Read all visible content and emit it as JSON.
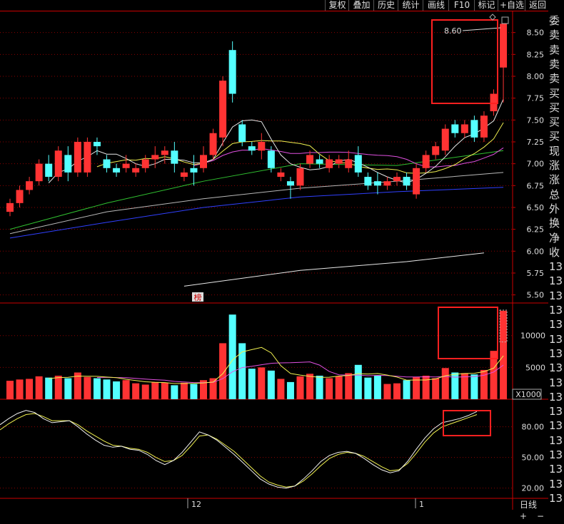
{
  "toolbar": {
    "buttons": [
      "复权",
      "叠加",
      "历史",
      "统计",
      "画线",
      "F10",
      "标记",
      "+自选",
      "返回"
    ]
  },
  "main_chart": {
    "price_ticks": [
      "8.50",
      "8.25",
      "8.00",
      "7.75",
      "7.50",
      "7.25",
      "7.00",
      "6.75",
      "6.50",
      "6.25",
      "6.00",
      "5.75",
      "5.50"
    ],
    "callout_value": "8.60",
    "marker": "榜"
  },
  "volume_chart": {
    "ticks": [
      "10000",
      "5000"
    ],
    "unit": "X1000"
  },
  "kdj_chart": {
    "ticks": [
      "80.00",
      "50.00",
      "20.00"
    ]
  },
  "date_axis": {
    "labels": [
      "12",
      "1"
    ]
  },
  "right_panel": {
    "labels": [
      "委",
      "卖",
      "卖",
      "卖",
      "卖",
      "买",
      "买",
      "买",
      "买",
      "现",
      "涨",
      "涨",
      "总",
      "外",
      "换",
      "净",
      "收",
      "13",
      "13",
      "13",
      "13",
      "13",
      "13",
      "13",
      "13",
      "13",
      "13",
      "13",
      "13",
      "13",
      "13",
      "13",
      "13",
      "13"
    ]
  },
  "bottom_tabs": {
    "period": "日线",
    "plus": "+",
    "minus": "−"
  },
  "colors": {
    "up": "#ff3333",
    "down": "#54ffff",
    "grid": "#8b0000",
    "axis": "#cc0000",
    "highlight": "#ff2020",
    "ma_white": "#e8e8e8",
    "ma_yellow": "#f0f050",
    "ma_magenta": "#e050e0",
    "ma_green": "#30c030",
    "ma_blue": "#3040ff",
    "ma_gray": "#b8b8b8"
  },
  "chart_data": {
    "type": "candlestick",
    "ylim": [
      5.5,
      8.6
    ],
    "candles": [
      [
        6.45,
        6.6,
        6.4,
        6.55
      ],
      [
        6.55,
        6.75,
        6.5,
        6.7
      ],
      [
        6.7,
        6.85,
        6.65,
        6.8
      ],
      [
        6.8,
        7.05,
        6.75,
        7.0
      ],
      [
        7.0,
        7.1,
        6.8,
        6.85
      ],
      [
        6.85,
        7.2,
        6.8,
        7.15
      ],
      [
        7.1,
        7.2,
        6.8,
        6.9
      ],
      [
        6.9,
        7.3,
        6.85,
        7.25
      ],
      [
        6.9,
        7.3,
        6.85,
        7.25
      ],
      [
        7.25,
        7.3,
        7.1,
        7.2
      ],
      [
        7.05,
        7.1,
        6.9,
        6.95
      ],
      [
        6.95,
        7.0,
        6.85,
        6.9
      ],
      [
        6.95,
        7.1,
        6.9,
        7.0
      ],
      [
        6.9,
        7.0,
        6.85,
        6.95
      ],
      [
        6.95,
        7.1,
        6.9,
        7.05
      ],
      [
        7.05,
        7.2,
        6.95,
        7.1
      ],
      [
        7.1,
        7.2,
        7.0,
        7.15
      ],
      [
        7.15,
        7.25,
        6.9,
        7.0
      ],
      [
        6.85,
        6.95,
        6.8,
        6.9
      ],
      [
        6.95,
        7.1,
        6.75,
        6.9
      ],
      [
        6.95,
        7.2,
        6.9,
        7.1
      ],
      [
        7.1,
        7.4,
        7.05,
        7.35
      ],
      [
        7.3,
        8.0,
        7.2,
        7.95
      ],
      [
        8.3,
        8.4,
        7.7,
        7.8
      ],
      [
        7.45,
        7.5,
        7.2,
        7.25
      ],
      [
        7.2,
        7.25,
        7.1,
        7.15
      ],
      [
        7.15,
        7.35,
        7.05,
        7.25
      ],
      [
        7.15,
        7.2,
        6.9,
        6.95
      ],
      [
        6.85,
        6.95,
        6.8,
        6.9
      ],
      [
        6.8,
        6.85,
        6.6,
        6.75
      ],
      [
        6.75,
        7.0,
        6.7,
        6.95
      ],
      [
        7.0,
        7.15,
        6.95,
        7.1
      ],
      [
        7.05,
        7.1,
        6.95,
        7.0
      ],
      [
        6.95,
        7.1,
        6.9,
        7.05
      ],
      [
        7.0,
        7.1,
        6.95,
        7.05
      ],
      [
        6.95,
        7.15,
        6.9,
        7.05
      ],
      [
        7.1,
        7.2,
        6.85,
        6.9
      ],
      [
        6.85,
        6.9,
        6.7,
        6.75
      ],
      [
        6.8,
        6.9,
        6.65,
        6.75
      ],
      [
        6.75,
        6.85,
        6.7,
        6.8
      ],
      [
        6.8,
        6.9,
        6.75,
        6.85
      ],
      [
        6.85,
        6.9,
        6.7,
        6.75
      ],
      [
        6.65,
        7.0,
        6.6,
        6.95
      ],
      [
        6.95,
        7.15,
        6.9,
        7.1
      ],
      [
        7.1,
        7.25,
        7.05,
        7.2
      ],
      [
        7.15,
        7.45,
        7.1,
        7.4
      ],
      [
        7.45,
        7.5,
        7.3,
        7.35
      ],
      [
        7.35,
        7.5,
        7.3,
        7.45
      ],
      [
        7.5,
        7.55,
        7.25,
        7.3
      ],
      [
        7.3,
        7.6,
        7.25,
        7.55
      ],
      [
        7.6,
        7.85,
        7.55,
        7.8
      ],
      [
        8.1,
        8.6,
        7.7,
        8.6
      ]
    ],
    "volume_ylim": [
      0,
      14000
    ],
    "volume": [
      2900,
      3100,
      3200,
      3600,
      3400,
      3700,
      3300,
      4200,
      3500,
      3300,
      3100,
      2800,
      3000,
      2500,
      2300,
      2700,
      2600,
      2200,
      2600,
      2400,
      3000,
      3300,
      8800,
      13300,
      8800,
      4800,
      5000,
      4500,
      3200,
      2700,
      3600,
      4000,
      3700,
      3300,
      3600,
      4100,
      5400,
      3400,
      3700,
      2400,
      2500,
      3000,
      3500,
      3700,
      3300,
      4900,
      4200,
      4100,
      3900,
      4600,
      7600,
      13900
    ],
    "kdj_ylim": [
      10,
      100
    ],
    "kdj": {
      "k": [
        82,
        88,
        93,
        96,
        94,
        88,
        84,
        85,
        86,
        80,
        73,
        67,
        62,
        60,
        61,
        58,
        57,
        53,
        47,
        43,
        47,
        55,
        65,
        75,
        72,
        67,
        60,
        53,
        45,
        37,
        29,
        24,
        21,
        20,
        22,
        29,
        37,
        46,
        52,
        55,
        56,
        54,
        49,
        43,
        38,
        35,
        37,
        46,
        58,
        69,
        78,
        84,
        86,
        88,
        91,
        95
      ],
      "d": [
        77,
        83,
        88,
        92,
        93,
        90,
        86,
        86,
        86,
        82,
        76,
        71,
        66,
        62,
        61,
        59,
        58,
        55,
        50,
        46,
        47,
        52,
        61,
        71,
        72,
        68,
        62,
        56,
        48,
        40,
        32,
        26,
        23,
        21,
        22,
        27,
        34,
        42,
        49,
        53,
        55,
        54,
        51,
        46,
        41,
        37,
        38,
        44,
        54,
        65,
        74,
        80,
        83,
        86,
        89,
        92
      ]
    }
  }
}
